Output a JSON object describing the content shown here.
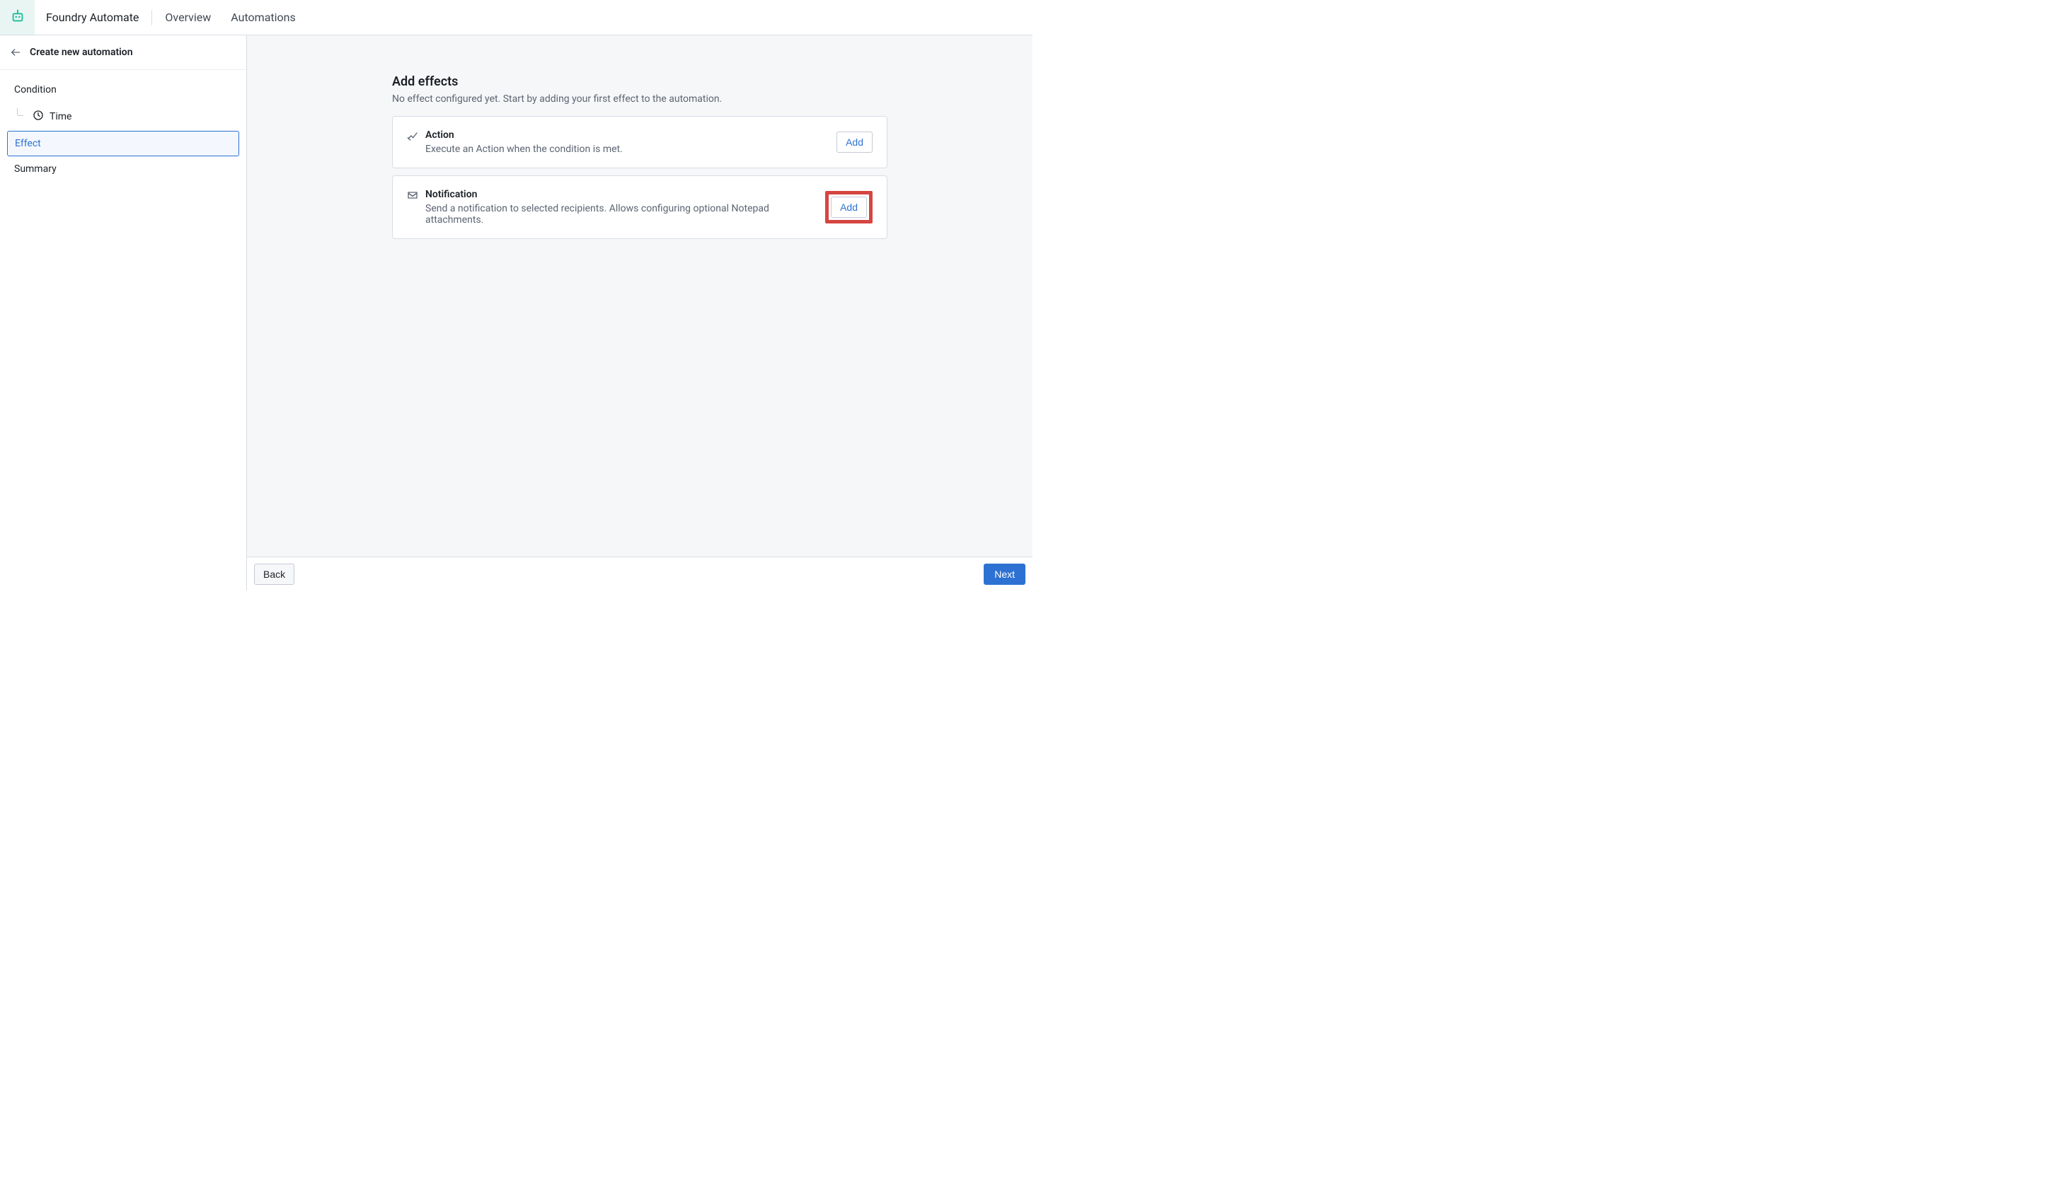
{
  "topbar": {
    "product": "Foundry Automate",
    "tabs": [
      {
        "label": "Overview"
      },
      {
        "label": "Automations"
      }
    ]
  },
  "sidebar": {
    "title": "Create new automation",
    "items": {
      "condition": "Condition",
      "condition_sub_time": "Time",
      "effect": "Effect",
      "summary": "Summary"
    }
  },
  "main": {
    "heading": "Add effects",
    "subheading": "No effect configured yet. Start by adding your first effect to the automation.",
    "effects": [
      {
        "title": "Action",
        "desc": "Execute an Action when the condition is met.",
        "add_label": "Add"
      },
      {
        "title": "Notification",
        "desc": "Send a notification to selected recipients. Allows configuring optional Notepad attachments.",
        "add_label": "Add"
      }
    ]
  },
  "footer": {
    "back": "Back",
    "next": "Next"
  }
}
